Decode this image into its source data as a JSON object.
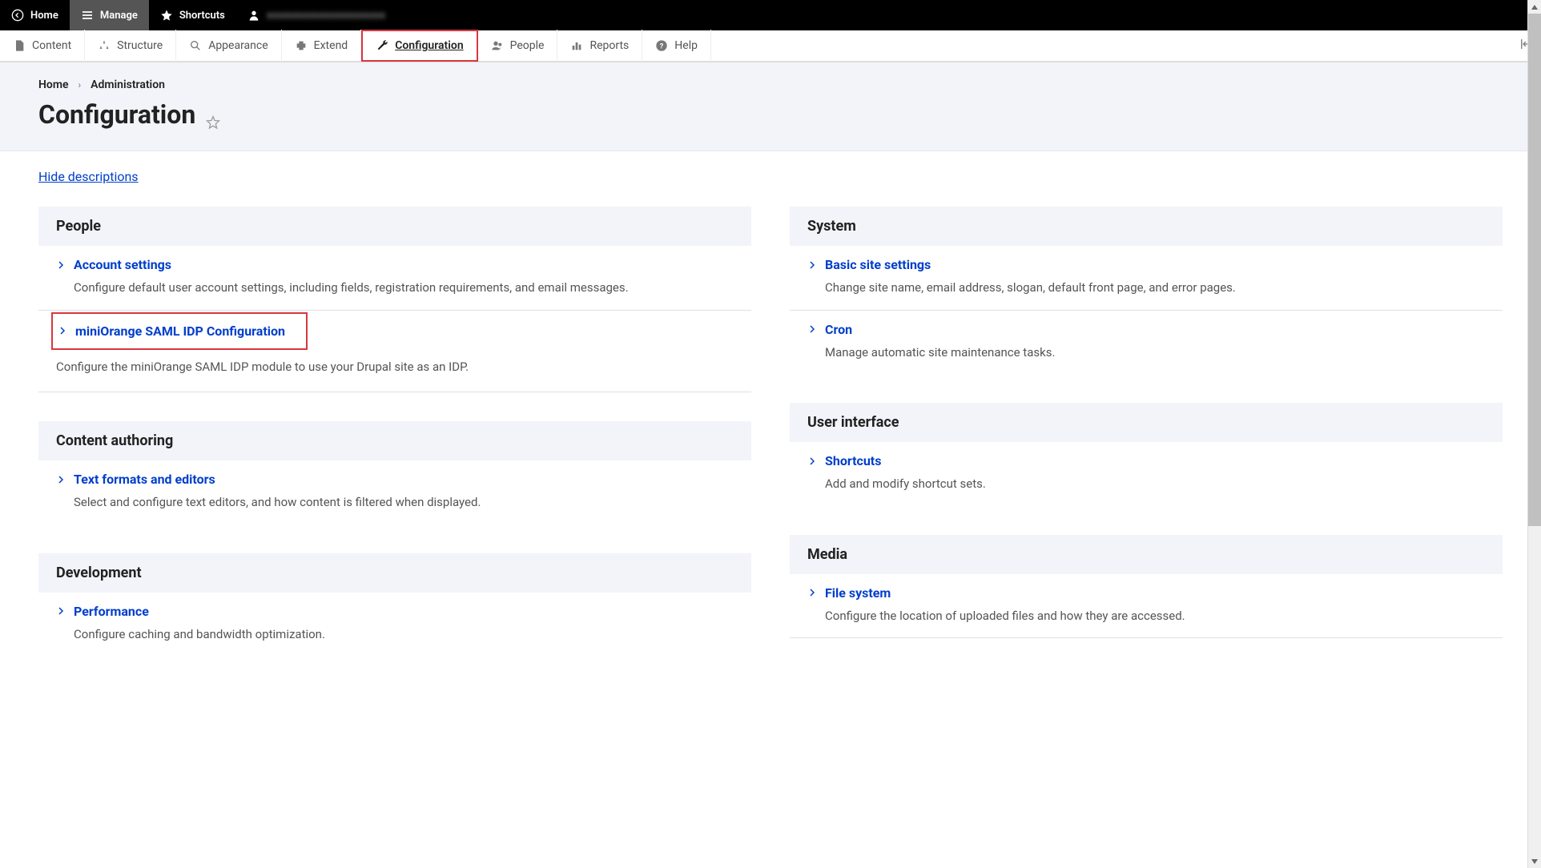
{
  "top_toolbar": {
    "home": "Home",
    "manage": "Manage",
    "shortcuts": "Shortcuts",
    "user": "xxxxxxxxxxxxxxxxxxxxxxx"
  },
  "admin_menu": {
    "content": "Content",
    "structure": "Structure",
    "appearance": "Appearance",
    "extend": "Extend",
    "configuration": "Configuration",
    "people": "People",
    "reports": "Reports",
    "help": "Help"
  },
  "breadcrumb": {
    "home": "Home",
    "admin": "Administration"
  },
  "page_title": "Configuration",
  "hide_descriptions": "Hide descriptions",
  "sections": {
    "left": [
      {
        "title": "People",
        "items": [
          {
            "label": "Account settings",
            "desc": "Configure default user account settings, including fields, registration requirements, and email messages.",
            "highlighted": false
          },
          {
            "label": "miniOrange SAML IDP Configuration",
            "desc": "Configure the miniOrange SAML IDP module to use your Drupal site as an IDP.",
            "highlighted": true
          }
        ]
      },
      {
        "title": "Content authoring",
        "items": [
          {
            "label": "Text formats and editors",
            "desc": "Select and configure text editors, and how content is filtered when displayed.",
            "highlighted": false
          }
        ]
      },
      {
        "title": "Development",
        "items": [
          {
            "label": "Performance",
            "desc": "Configure caching and bandwidth optimization.",
            "highlighted": false
          }
        ]
      }
    ],
    "right": [
      {
        "title": "System",
        "items": [
          {
            "label": "Basic site settings",
            "desc": "Change site name, email address, slogan, default front page, and error pages.",
            "highlighted": false
          },
          {
            "label": "Cron",
            "desc": "Manage automatic site maintenance tasks.",
            "highlighted": false
          }
        ]
      },
      {
        "title": "User interface",
        "items": [
          {
            "label": "Shortcuts",
            "desc": "Add and modify shortcut sets.",
            "highlighted": false
          }
        ]
      },
      {
        "title": "Media",
        "items": [
          {
            "label": "File system",
            "desc": "Configure the location of uploaded files and how they are accessed.",
            "highlighted": false
          }
        ]
      }
    ]
  }
}
